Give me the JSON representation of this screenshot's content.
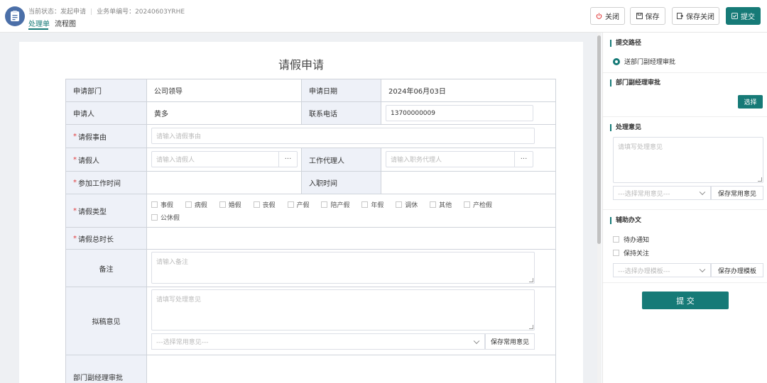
{
  "header": {
    "status_label": "当前状态：发起申请",
    "doc_no_label": "业务单编号：20240603YRHE",
    "tabs": [
      {
        "label": "处理单"
      },
      {
        "label": "流程图"
      }
    ],
    "buttons": {
      "close": "关闭",
      "save": "保存",
      "save_close": "保存关闭",
      "submit": "提交"
    }
  },
  "form": {
    "title": "请假申请",
    "dept_label": "申请部门",
    "dept_value": "公司领导",
    "date_label": "申请日期",
    "date_value": "2024年06月03日",
    "applicant_label": "申请人",
    "applicant_value": "黄多",
    "phone_label": "联系电话",
    "phone_value": "13700000009",
    "reason_label": "请假事由",
    "reason_placeholder": "请输入请假事由",
    "leave_person_label": "请假人",
    "leave_person_placeholder": "请输入请假人",
    "agent_label": "工作代理人",
    "agent_placeholder": "请输入职务代理人",
    "work_start_label": "参加工作时间",
    "join_date_label": "入职时间",
    "leave_type_label": "请假类型",
    "leave_types": [
      "事假",
      "病假",
      "婚假",
      "丧假",
      "产假",
      "陪产假",
      "年假",
      "调休",
      "其他",
      "产检假",
      "公休假"
    ],
    "total_label": "请假总时长",
    "remark_label": "备注",
    "remark_placeholder": "请输入备注",
    "draft_label": "拟稿意见",
    "draft_placeholder": "请填写处理意见",
    "common_select_placeholder": "---选择常用意见---",
    "save_common_label": "保存常用意见",
    "dept_approval_label": "部门副经理审批",
    "dots": "···"
  },
  "right_panel": {
    "route_title": "提交路径",
    "route_option": "送部门副经理审批",
    "approver_title": "部门副经理审批",
    "choose_label": "选择",
    "opinion_title": "处理意见",
    "opinion_placeholder": "请填写处理意见",
    "opinion_select": "---选择常用意见---",
    "opinion_save": "保存常用意见",
    "aux_title": "辅助办文",
    "aux_items": [
      "待办通知",
      "保持关注"
    ],
    "template_select": "---选择办理模板---",
    "template_save": "保存办理模板",
    "submit_label": "提  交"
  },
  "colors": {
    "accent": "#167a77",
    "label_bg": "#eef1f8",
    "required": "#e03b3b"
  }
}
